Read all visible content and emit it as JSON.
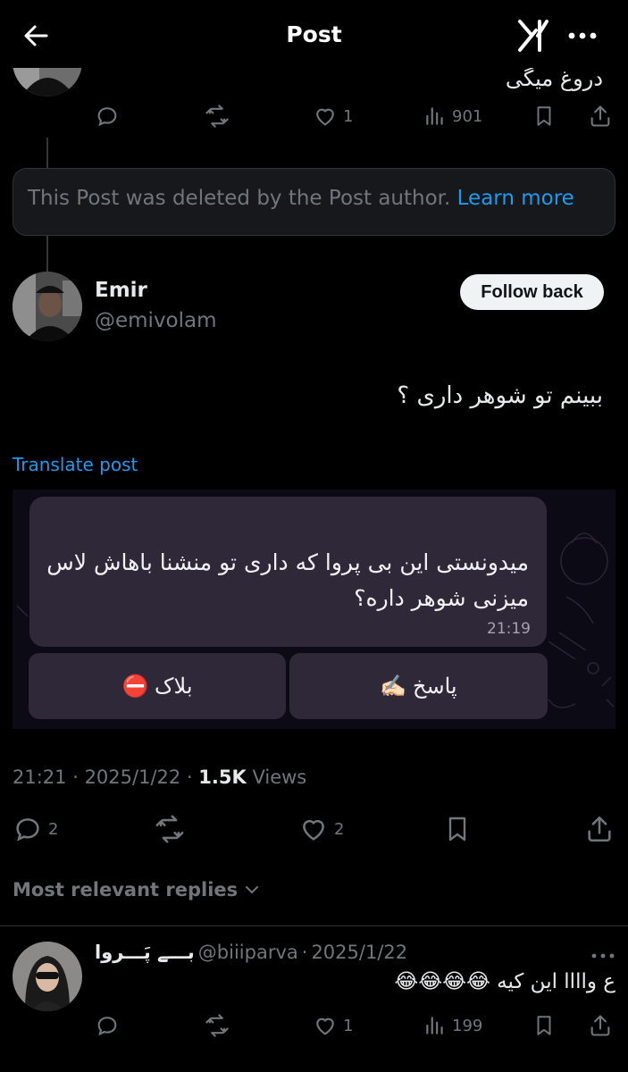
{
  "header": {
    "title": "Post"
  },
  "parent_post": {
    "text": "دروغ میگی",
    "replies": "",
    "reposts": "",
    "likes": "1",
    "views": "901"
  },
  "deleted_notice": {
    "text": "This Post was deleted by the Post author.",
    "link": "Learn more"
  },
  "main_post": {
    "display_name": "Emir",
    "handle": "@emivolam",
    "follow_label": "Follow back",
    "text": "ببینم تو شوهر داری ؟",
    "translate_label": "Translate post",
    "screenshot": {
      "message": "میدونستی این بی پروا که داری تو منشنا باهاش لاس میزنی شوهر داره؟",
      "time": "21:19",
      "block_label": "⛔ بلاک",
      "reply_label": "✍🏻 پاسخ"
    },
    "time": "21:21",
    "date": "2025/1/22",
    "views_count": "1.5K",
    "views_label": "Views",
    "replies": "2",
    "likes": "2"
  },
  "sort": {
    "label": "Most relevant replies"
  },
  "reply": {
    "display_name": "بـــے پَـــروا",
    "handle": "@biiiparva",
    "date": "2025/1/22",
    "text": "ع واااا این کیه 😂😂😂😂",
    "replies": "",
    "reposts": "",
    "likes": "1",
    "views": "199"
  },
  "colors": {
    "accent": "#1d9bf0",
    "muted": "#71767b",
    "background": "#000000"
  }
}
